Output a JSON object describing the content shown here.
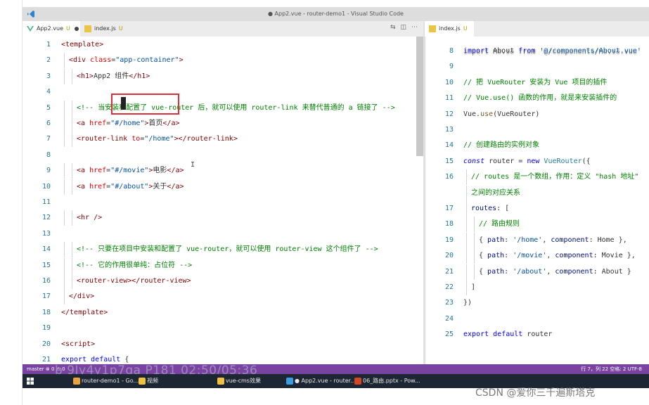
{
  "window": {
    "title": "● App2.vue - router-demo1 - Visual Studio Code"
  },
  "tabs": [
    {
      "label": "App2.vue",
      "status": "U",
      "modified": true
    },
    {
      "label": "index.js",
      "status": "U"
    }
  ],
  "tabs_right": [
    {
      "label": "index.js",
      "status": "U"
    }
  ],
  "left_code": [
    {
      "n": "1",
      "i": 0,
      "t": [
        [
          "tag",
          "<template>"
        ]
      ]
    },
    {
      "n": "2",
      "i": 1,
      "t": [
        [
          "tag",
          "<div"
        ],
        [
          "txt",
          " "
        ],
        [
          "attr",
          "class"
        ],
        [
          "txt",
          "="
        ],
        [
          "str",
          "\"app-container\""
        ],
        [
          "tag",
          ">"
        ]
      ]
    },
    {
      "n": "3",
      "i": 2,
      "t": [
        [
          "tag",
          "<h1>"
        ],
        [
          "txt",
          "App2 组件"
        ],
        [
          "tag",
          "</h1>"
        ]
      ]
    },
    {
      "n": "4",
      "i": 0,
      "t": []
    },
    {
      "n": "5",
      "i": 2,
      "t": [
        [
          "cmt",
          "<!-- 当安装和配置了 vue-router 后，就可以使用 router-link 来替代普通的 a 链接了 -->"
        ]
      ]
    },
    {
      "n": "6",
      "i": 2,
      "t": [
        [
          "tag",
          "<a"
        ],
        [
          "txt",
          " "
        ],
        [
          "attr",
          "href"
        ],
        [
          "txt",
          "="
        ],
        [
          "str",
          "\"#/home\""
        ],
        [
          "tag",
          ">"
        ],
        [
          "txt",
          "首页"
        ],
        [
          "tag",
          "</a>"
        ]
      ]
    },
    {
      "n": "7",
      "i": 2,
      "t": [
        [
          "tag",
          "<router-link"
        ],
        [
          "txt",
          " "
        ],
        [
          "attr",
          "to"
        ],
        [
          "txt",
          "="
        ],
        [
          "str",
          "\"/home\""
        ],
        [
          "tag",
          ">"
        ],
        [
          "tag",
          "</router-link>"
        ]
      ]
    },
    {
      "n": "8",
      "i": 0,
      "t": []
    },
    {
      "n": "9",
      "i": 2,
      "t": [
        [
          "tag",
          "<a"
        ],
        [
          "txt",
          " "
        ],
        [
          "attr",
          "href"
        ],
        [
          "txt",
          "="
        ],
        [
          "str",
          "\"#/movie\""
        ],
        [
          "tag",
          ">"
        ],
        [
          "txt",
          "电影"
        ],
        [
          "tag",
          "</a>"
        ]
      ]
    },
    {
      "n": "10",
      "i": 2,
      "t": [
        [
          "tag",
          "<a"
        ],
        [
          "txt",
          " "
        ],
        [
          "attr",
          "href"
        ],
        [
          "txt",
          "="
        ],
        [
          "str",
          "\"#/about\""
        ],
        [
          "tag",
          ">"
        ],
        [
          "txt",
          "关于"
        ],
        [
          "tag",
          "</a>"
        ]
      ]
    },
    {
      "n": "11",
      "i": 0,
      "t": []
    },
    {
      "n": "12",
      "i": 2,
      "t": [
        [
          "tag",
          "<hr />"
        ]
      ]
    },
    {
      "n": "13",
      "i": 0,
      "t": []
    },
    {
      "n": "14",
      "i": 2,
      "t": [
        [
          "cmt",
          "<!-- 只要在项目中安装和配置了 vue-router，就可以使用 router-view 这个组件了 -->"
        ]
      ]
    },
    {
      "n": "15",
      "i": 2,
      "t": [
        [
          "cmt",
          "<!-- 它的作用很单纯：占位符 -->"
        ]
      ]
    },
    {
      "n": "16",
      "i": 2,
      "t": [
        [
          "tag",
          "<router-view>"
        ],
        [
          "tag",
          "</router-view>"
        ]
      ]
    },
    {
      "n": "17",
      "i": 1,
      "t": [
        [
          "tag",
          "</div>"
        ]
      ]
    },
    {
      "n": "18",
      "i": 0,
      "t": [
        [
          "tag",
          "</template>"
        ]
      ]
    },
    {
      "n": "19",
      "i": 0,
      "t": []
    },
    {
      "n": "20",
      "i": 0,
      "t": [
        [
          "tag",
          "<script>"
        ]
      ]
    },
    {
      "n": "21",
      "i": 0,
      "t": [
        [
          "kw",
          "export"
        ],
        [
          "txt",
          " "
        ],
        [
          "kw",
          "default"
        ],
        [
          "txt",
          " {"
        ]
      ]
    }
  ],
  "right_code": [
    {
      "n": "8",
      "i": 0,
      "t": [
        [
          "kw",
          "import"
        ],
        [
          "txt",
          " About "
        ],
        [
          "kw",
          "from"
        ],
        [
          "txt",
          " "
        ],
        [
          "str",
          "'@/components/About.vue'"
        ]
      ]
    },
    {
      "n": "9",
      "i": 0,
      "t": []
    },
    {
      "n": "10",
      "i": 0,
      "t": [
        [
          "cmt",
          "// 把 VueRouter 安装为 Vue 项目的插件"
        ]
      ]
    },
    {
      "n": "11",
      "i": 0,
      "t": [
        [
          "cmt",
          "// Vue.use() 函数的作用，就是来安装插件的"
        ]
      ]
    },
    {
      "n": "12",
      "i": 0,
      "t": [
        [
          "txt",
          "Vue."
        ],
        [
          "fn",
          "use"
        ],
        [
          "txt",
          "(VueRouter)"
        ]
      ]
    },
    {
      "n": "13",
      "i": 0,
      "t": []
    },
    {
      "n": "14",
      "i": 0,
      "t": [
        [
          "cmt",
          "// 创建路由的实例对象"
        ]
      ]
    },
    {
      "n": "15",
      "i": 0,
      "t": [
        [
          "kw ital",
          "const"
        ],
        [
          "txt",
          " router = "
        ],
        [
          "kw",
          "new"
        ],
        [
          "txt",
          " "
        ],
        [
          "cls",
          "VueRouter"
        ],
        [
          "txt",
          "({"
        ]
      ]
    },
    {
      "n": "16",
      "i": 1,
      "t": [
        [
          "cmt",
          "// routes 是一个数组，作用：定义 \"hash 地址\""
        ]
      ]
    },
    {
      "n": "",
      "i": 1,
      "t": [
        [
          "cmt",
          "之间的对应关系"
        ]
      ]
    },
    {
      "n": "17",
      "i": 1,
      "t": [
        [
          "var",
          "routes"
        ],
        [
          "txt",
          ": ["
        ]
      ]
    },
    {
      "n": "18",
      "i": 2,
      "t": [
        [
          "cmt",
          "// 路由规则"
        ]
      ]
    },
    {
      "n": "19",
      "i": 2,
      "t": [
        [
          "txt",
          "{ "
        ],
        [
          "var",
          "path"
        ],
        [
          "txt",
          ": "
        ],
        [
          "str",
          "'/home'"
        ],
        [
          "txt",
          ", "
        ],
        [
          "var",
          "component"
        ],
        [
          "txt",
          ": Home },"
        ]
      ]
    },
    {
      "n": "20",
      "i": 2,
      "t": [
        [
          "txt",
          "{ "
        ],
        [
          "var",
          "path"
        ],
        [
          "txt",
          ": "
        ],
        [
          "str",
          "'/movie'"
        ],
        [
          "txt",
          ", "
        ],
        [
          "var",
          "component"
        ],
        [
          "txt",
          ": Movie },"
        ]
      ]
    },
    {
      "n": "21",
      "i": 2,
      "t": [
        [
          "txt",
          "{ "
        ],
        [
          "var",
          "path"
        ],
        [
          "txt",
          ": "
        ],
        [
          "str",
          "'/about'"
        ],
        [
          "txt",
          ", "
        ],
        [
          "var",
          "component"
        ],
        [
          "txt",
          ": About }"
        ]
      ]
    },
    {
      "n": "22",
      "i": 1,
      "t": [
        [
          "txt",
          "]"
        ]
      ]
    },
    {
      "n": "23",
      "i": 0,
      "t": [
        [
          "txt",
          "})"
        ]
      ]
    },
    {
      "n": "24",
      "i": 0,
      "t": []
    },
    {
      "n": "25",
      "i": 0,
      "t": [
        [
          "kw",
          "export"
        ],
        [
          "txt",
          " "
        ],
        [
          "kw",
          "default"
        ],
        [
          "txt",
          " router"
        ]
      ]
    }
  ],
  "right_partial_line": "import Movie from '@/components/Movie.vue'",
  "statusbar": {
    "left": "master  ⊗ 0 ⚠ 0",
    "right": "行 7，列 22   空格: 2   UTF-8"
  },
  "watermark": "b 9Jy4y1p7ga P181 02:50/05:36",
  "taskbar": [
    {
      "label": "router-demo1 - Go...",
      "icon_color": "#e8a33d"
    },
    {
      "label": "视频",
      "icon_color": "#f0c040"
    },
    {
      "label": "vue-cms效果",
      "icon_color": "#f0c040"
    },
    {
      "label": "● App2.vue - router...",
      "icon_color": "#3c9de0"
    },
    {
      "label": "06_路由.pptx - Pow...",
      "icon_color": "#d24726"
    }
  ],
  "csdn_watermark": "CSDN @爱你三千遍斯塔克",
  "colors": {
    "statusbar": "#7b43a1",
    "taskbar": "#1d2733",
    "selection_box": "#d9303b"
  }
}
